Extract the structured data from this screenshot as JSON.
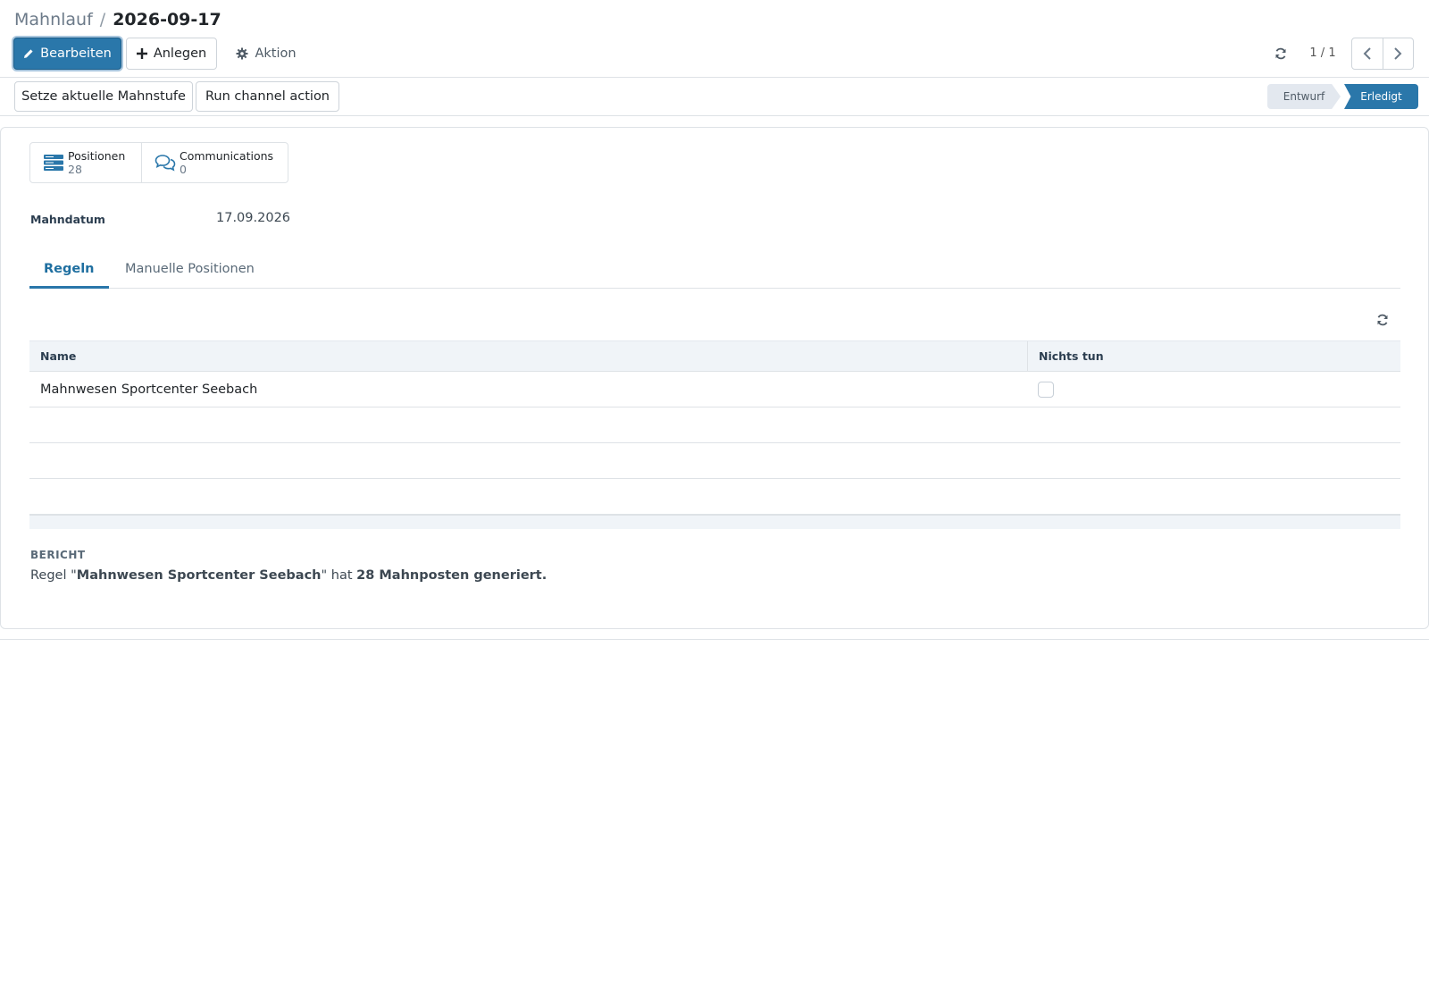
{
  "breadcrumb": {
    "parent": "Mahnlauf",
    "separator": "/",
    "current": "2026-09-17"
  },
  "toolbar": {
    "edit_label": "Bearbeiten",
    "create_label": "Anlegen",
    "action_label": "Aktion"
  },
  "pager": {
    "value": "1 / 1"
  },
  "statusbar": {
    "buttons": [
      "Setze aktuelle Mahnstufe",
      "Run channel action"
    ],
    "stages": [
      "Entwurf",
      "Erledigt"
    ],
    "active_stage": "Erledigt"
  },
  "smart_buttons": [
    {
      "label": "Positionen",
      "value": "28",
      "icon": "list-icon"
    },
    {
      "label": "Communications",
      "value": "0",
      "icon": "comments-icon"
    }
  ],
  "fields": {
    "mahndatum_label": "Mahndatum",
    "mahndatum_value": "17.09.2026"
  },
  "tabs": [
    "Regeln",
    "Manuelle Positionen"
  ],
  "table": {
    "columns": [
      "Name",
      "Nichts tun"
    ],
    "rows": [
      {
        "name": "Mahnwesen Sportcenter Seebach",
        "nichts_tun": false
      }
    ]
  },
  "report": {
    "label": "BERICHT",
    "prefix": "Regel \"",
    "rule_name": "Mahnwesen Sportcenter Seebach",
    "middle": "\" hat ",
    "result": "28 Mahnposten generiert."
  },
  "colors": {
    "primary": "#2a77aa",
    "stage_inactive": "#e3e8ef",
    "table_header_bg": "#f0f4f8"
  }
}
